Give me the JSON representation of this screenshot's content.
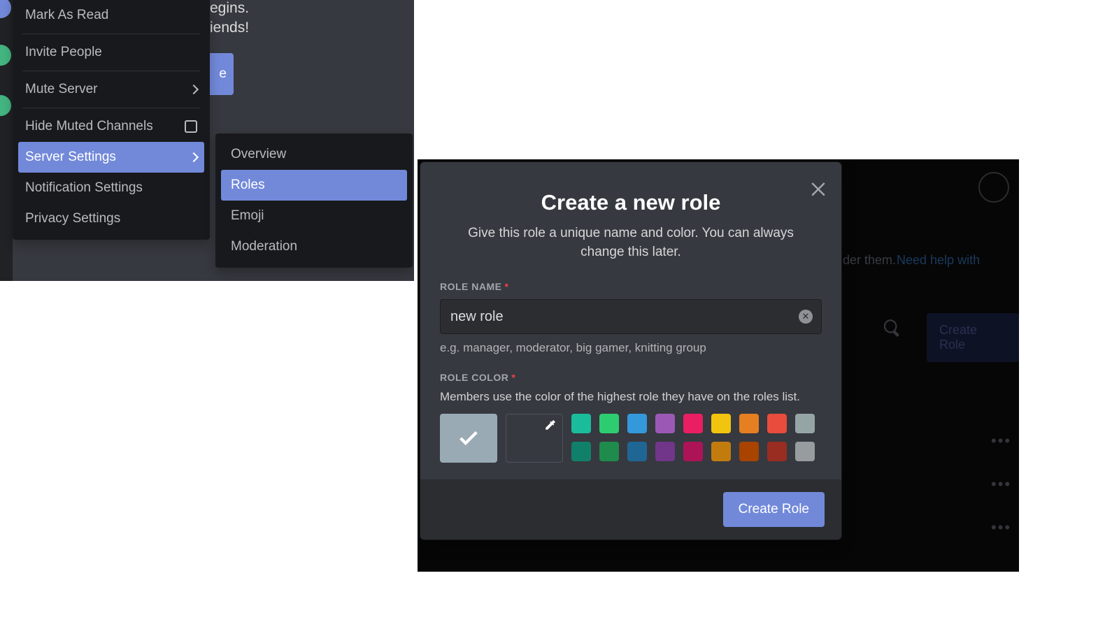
{
  "left": {
    "bg": {
      "line1": "egins.",
      "line2": "iends!",
      "button_frag": "e"
    },
    "menu": [
      {
        "id": "mark-as-read",
        "label": "Mark As Read",
        "divider_after": true
      },
      {
        "id": "invite-people",
        "label": "Invite People",
        "divider_after": true
      },
      {
        "id": "mute-server",
        "label": "Mute Server",
        "chevron": true,
        "divider_after": true
      },
      {
        "id": "hide-muted",
        "label": "Hide Muted Channels",
        "checkbox": true
      },
      {
        "id": "server-settings",
        "label": "Server Settings",
        "chevron": true,
        "selected": true
      },
      {
        "id": "notification-settings",
        "label": "Notification Settings"
      },
      {
        "id": "privacy-settings",
        "label": "Privacy Settings"
      }
    ],
    "submenu": [
      {
        "id": "overview",
        "label": "Overview"
      },
      {
        "id": "roles",
        "label": "Roles",
        "selected": true
      },
      {
        "id": "emoji",
        "label": "Emoji"
      },
      {
        "id": "moderation",
        "label": "Moderation"
      }
    ]
  },
  "right": {
    "bg": {
      "hint_fragment": "der them.",
      "link_fragment": "Need help with",
      "create_role_button": "Create Role"
    },
    "modal": {
      "title": "Create a new role",
      "subtitle": "Give this role a unique name and color. You can always change this later.",
      "role_name": {
        "label": "ROLE NAME",
        "value": "new role",
        "hint": "e.g. manager, moderator, big gamer, knitting group"
      },
      "role_color": {
        "label": "ROLE COLOR",
        "desc": "Members use the color of the highest role they have on the roles list.",
        "default_color": "#99aab5",
        "row1": [
          "#1abc9c",
          "#2ecc71",
          "#3498db",
          "#9b59b6",
          "#e91e63",
          "#f1c40f",
          "#e67e22",
          "#e74c3c",
          "#95a5a6"
        ],
        "row2": [
          "#11806a",
          "#1f8b4c",
          "#206694",
          "#71368a",
          "#ad1457",
          "#c27c0e",
          "#a84300",
          "#992d22",
          "#979c9f"
        ]
      },
      "submit": "Create Role"
    }
  }
}
